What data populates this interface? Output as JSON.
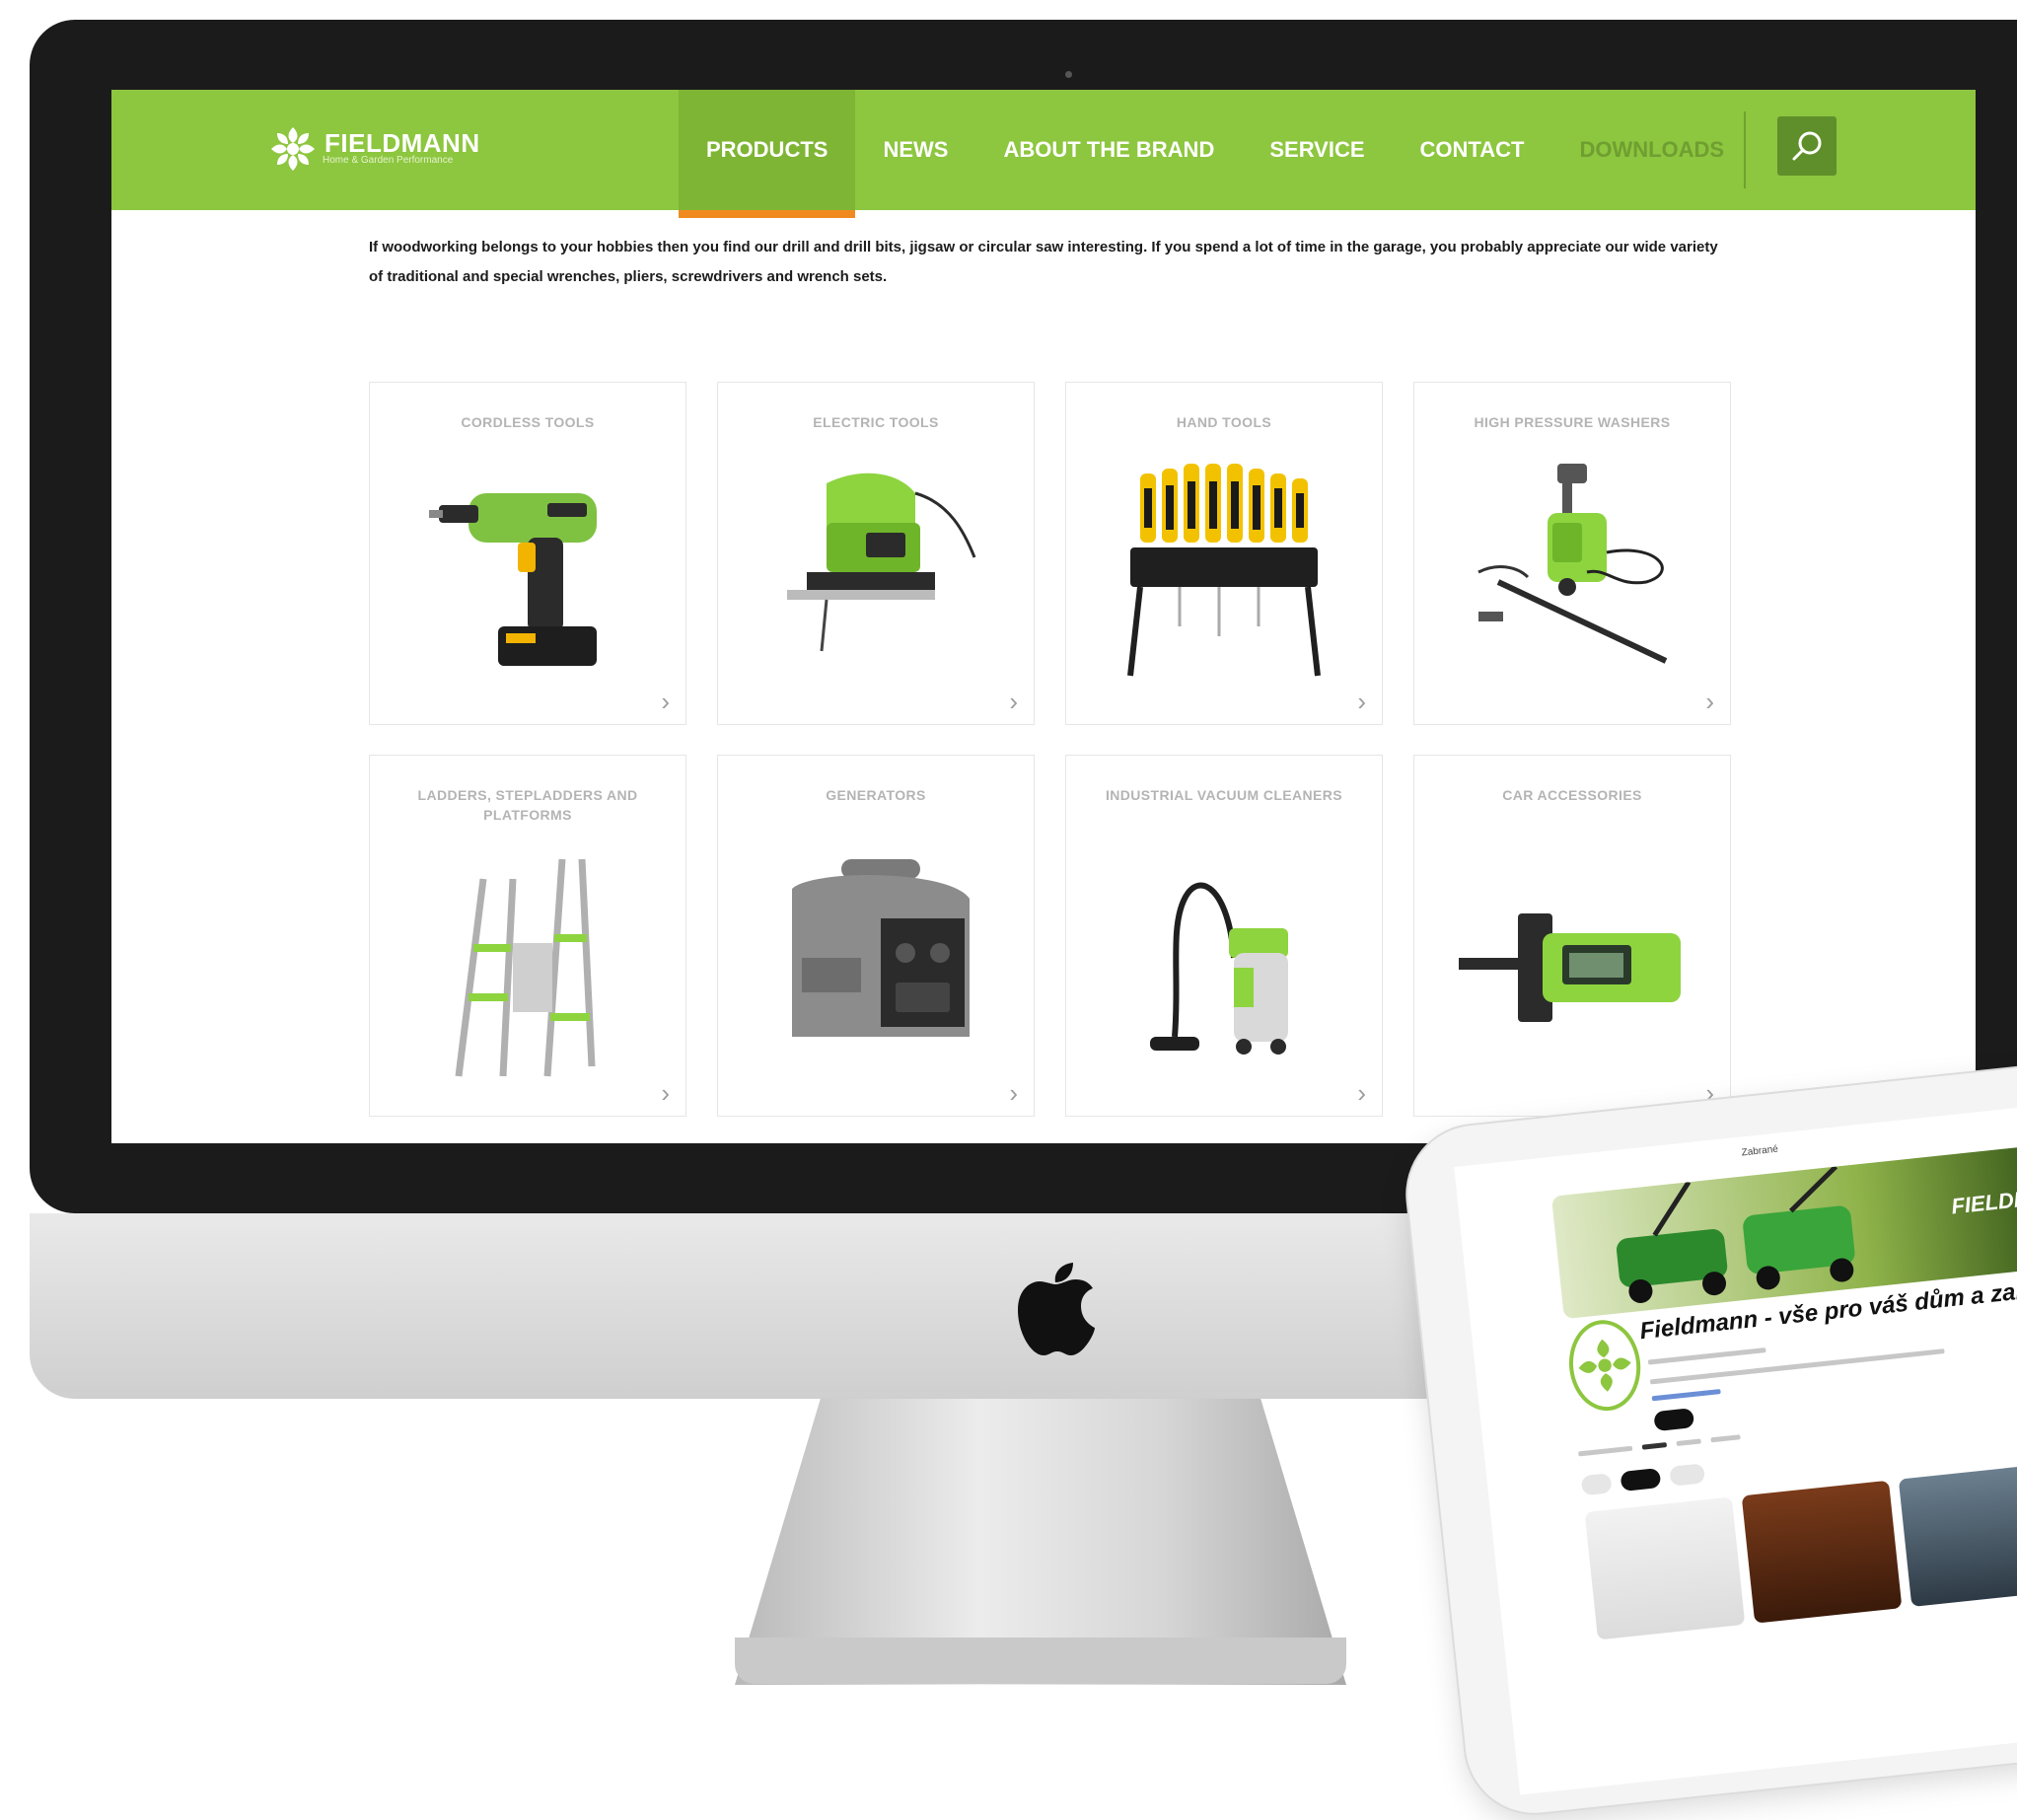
{
  "site": {
    "brand": {
      "name": "FIELDMANN",
      "sub": "Home & Garden Performance"
    },
    "nav": [
      {
        "label": "PRODUCTS",
        "active": true
      },
      {
        "label": "NEWS",
        "active": false
      },
      {
        "label": "ABOUT THE BRAND",
        "active": false
      },
      {
        "label": "SERVICE",
        "active": false
      },
      {
        "label": "CONTACT",
        "active": false
      },
      {
        "label": "DOWNLOADS",
        "active": false
      }
    ],
    "intro": "If woodworking belongs to your hobbies then you find our drill and drill bits, jigsaw or circular saw interesting. If you spend a lot of time in the garage, you probably appreciate our wide variety of traditional and special wrenches, pliers, screwdrivers and wrench sets.",
    "categories": [
      {
        "title": "CORDLESS TOOLS",
        "icon": "cordless-drill-icon"
      },
      {
        "title": "ELECTRIC TOOLS",
        "icon": "jigsaw-icon"
      },
      {
        "title": "HAND TOOLS",
        "icon": "screwdriver-set-icon"
      },
      {
        "title": "HIGH PRESSURE WASHERS",
        "icon": "pressure-washer-icon"
      },
      {
        "title": "LADDERS, STEPLADDERS AND PLATFORMS",
        "icon": "ladder-icon"
      },
      {
        "title": "GENERATORS",
        "icon": "generator-icon"
      },
      {
        "title": "INDUSTRIAL VACUUM CLEANERS",
        "icon": "vacuum-cleaner-icon"
      },
      {
        "title": "CAR ACCESSORIES",
        "icon": "tyre-gauge-icon"
      }
    ],
    "arrow": "›",
    "colors": {
      "green": "#8dc63f",
      "accent": "#f18a1e",
      "dark_green": "#5f8f2a"
    }
  },
  "tablet": {
    "window_title": "Zabrané",
    "window_controls": "▫ ✕",
    "banner_logo": "FIELDMA",
    "channel_title": "Fieldmann - vše pro váš dům a zahradu"
  }
}
